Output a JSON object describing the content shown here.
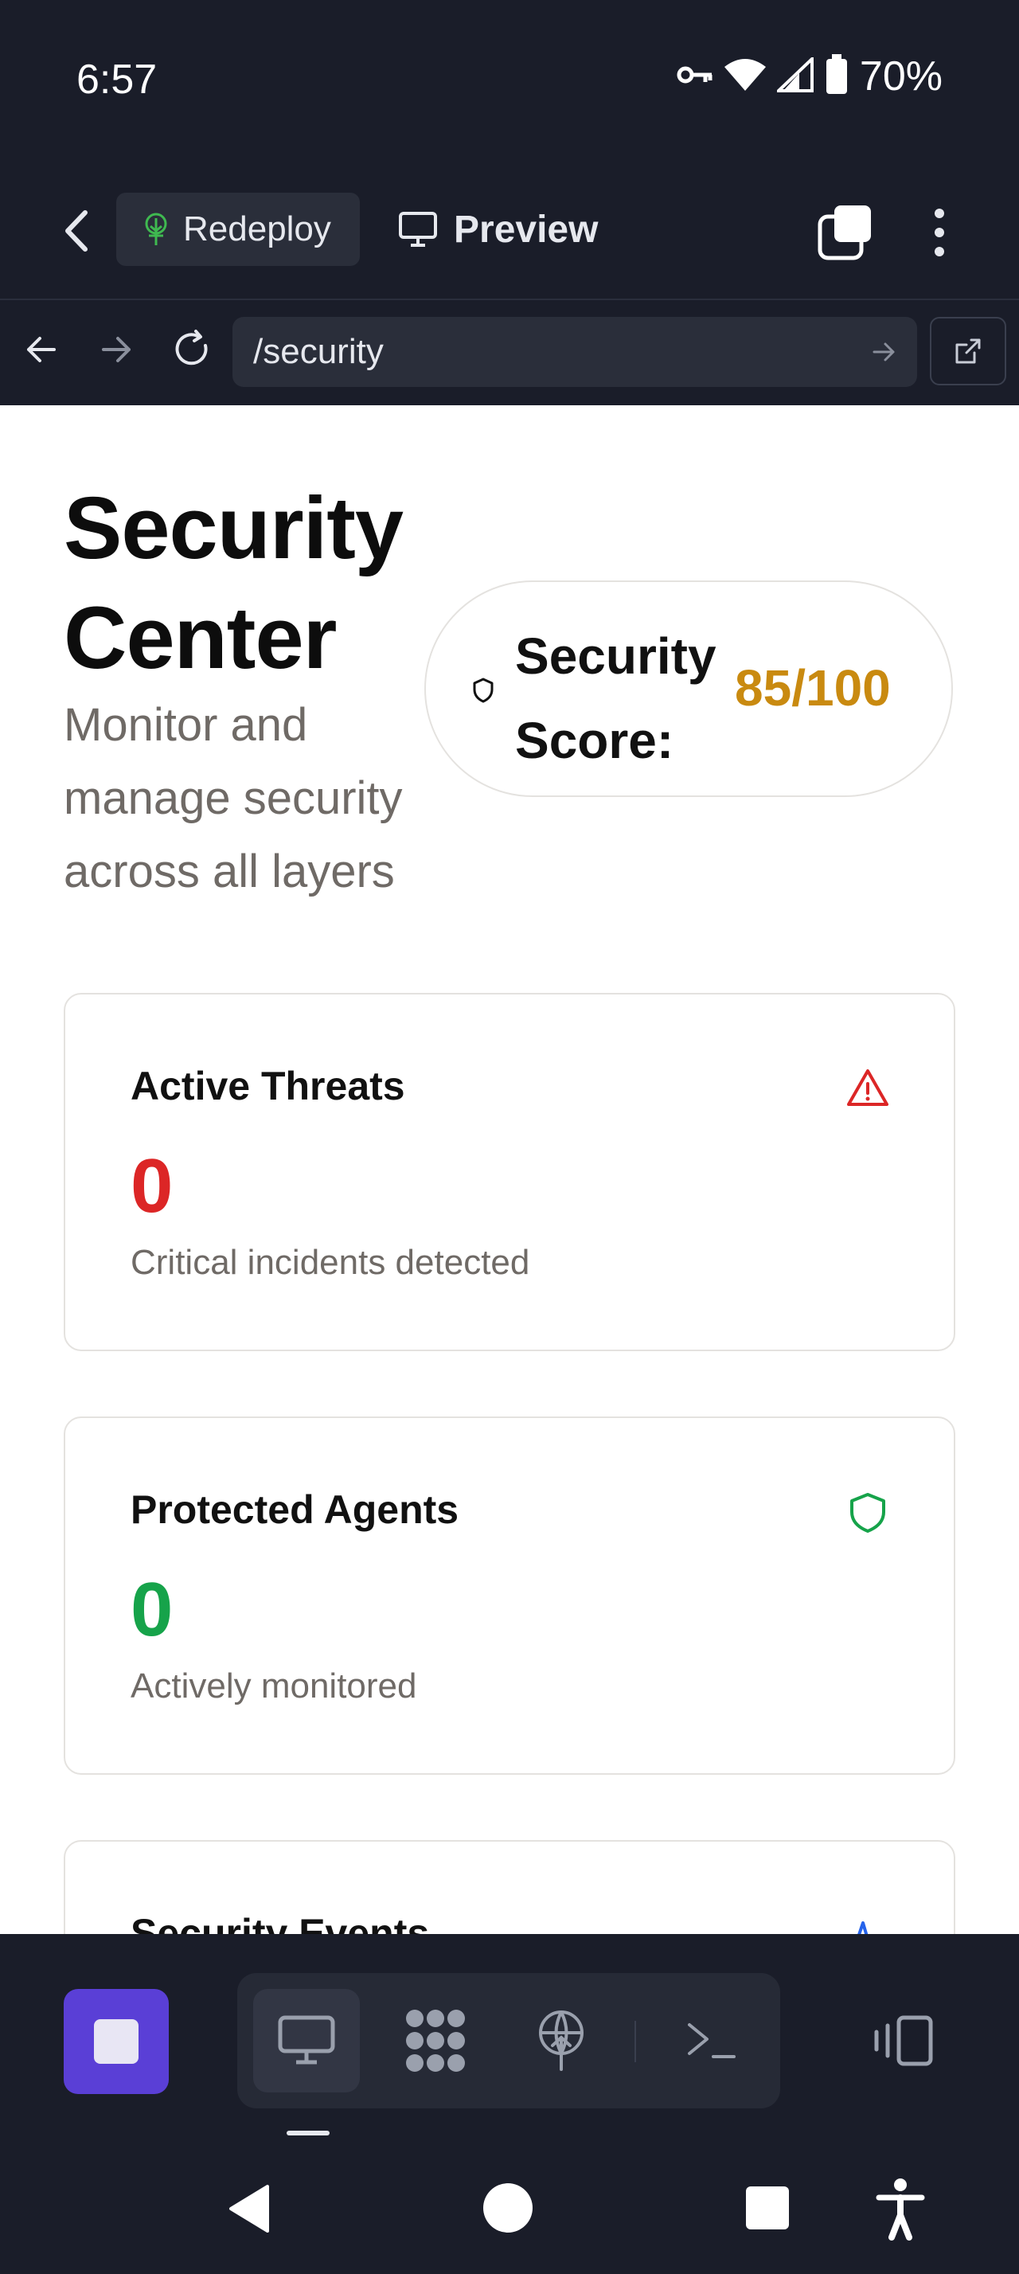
{
  "status_bar": {
    "time": "6:57",
    "battery": "70%"
  },
  "header": {
    "redeploy_label": "Redeploy",
    "preview_label": "Preview"
  },
  "url_bar": {
    "url": "/security"
  },
  "page": {
    "title": "Security Center",
    "subtitle": "Monitor and manage security across all layers",
    "score_label": "Security Score:",
    "score_value": "85/100"
  },
  "cards": [
    {
      "title": "Active Threats",
      "value": "0",
      "description": "Critical incidents detected",
      "icon": "warning-triangle-icon",
      "color": "#dc2626"
    },
    {
      "title": "Protected Agents",
      "value": "0",
      "description": "Actively monitored",
      "icon": "shield-icon",
      "color": "#16a34a"
    },
    {
      "title": "Security Events",
      "icon": "activity-icon",
      "color": "#2563eb"
    }
  ],
  "colors": {
    "accent_purple": "#5a3fd6",
    "score": "#c98a10",
    "app_bg": "#1a1d29"
  }
}
